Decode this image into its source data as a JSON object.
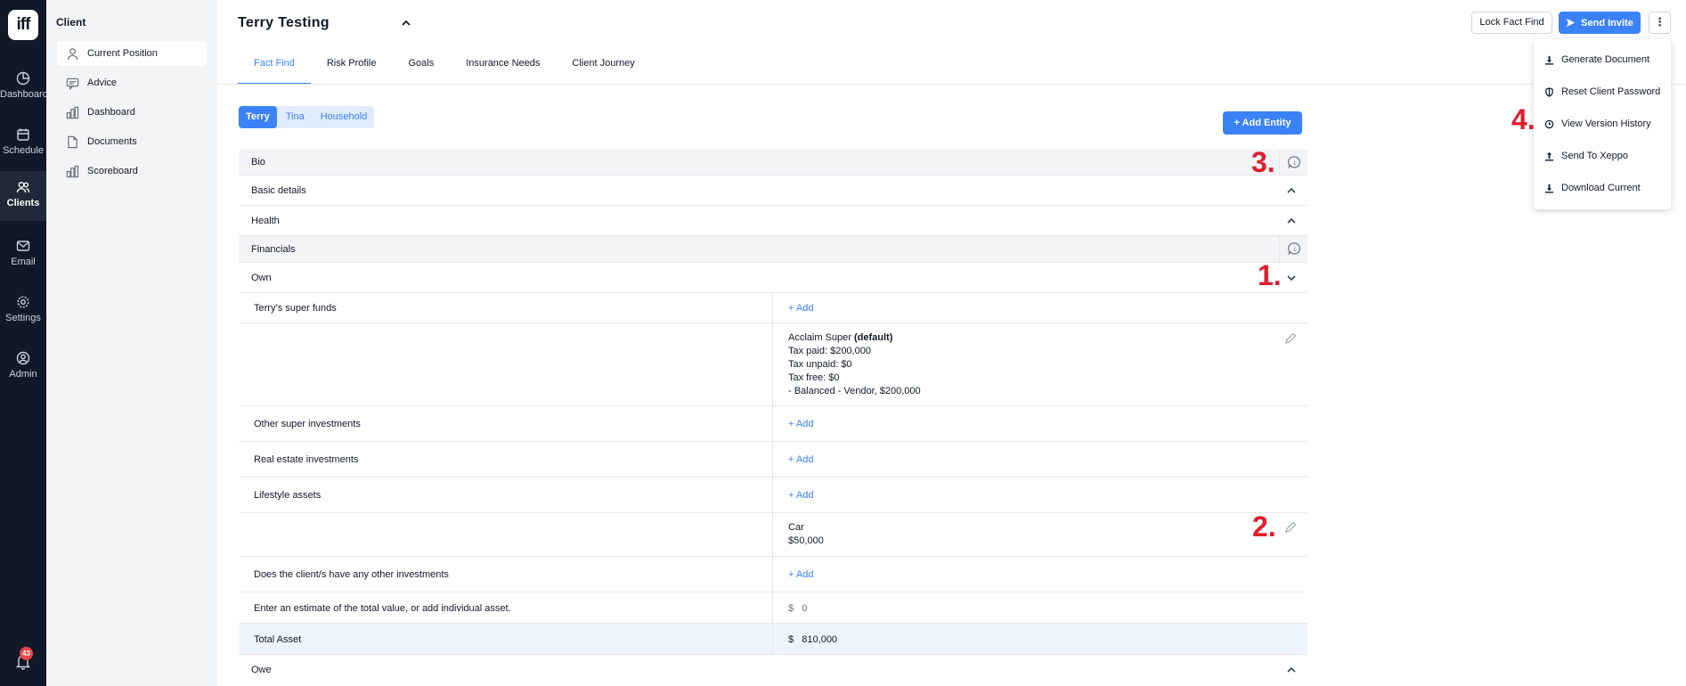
{
  "rail": {
    "logo": "iff",
    "items": [
      {
        "label": "Dashboard"
      },
      {
        "label": "Schedule"
      },
      {
        "label": "Clients"
      },
      {
        "label": "Email"
      },
      {
        "label": "Settings"
      },
      {
        "label": "Admin"
      }
    ],
    "notification_count": "43"
  },
  "sidebar": {
    "title": "Client",
    "items": [
      {
        "label": "Current Position"
      },
      {
        "label": "Advice"
      },
      {
        "label": "Dashboard"
      },
      {
        "label": "Documents"
      },
      {
        "label": "Scoreboard"
      }
    ]
  },
  "header": {
    "title": "Terry Testing",
    "lock_label": "Lock Fact Find",
    "send_invite_label": "Send Invite",
    "more_label": "⋮"
  },
  "tabs": [
    {
      "label": "Fact Find"
    },
    {
      "label": "Risk Profile"
    },
    {
      "label": "Goals"
    },
    {
      "label": "Insurance Needs"
    },
    {
      "label": "Client Journey"
    }
  ],
  "entities": {
    "pills": [
      {
        "label": "Terry"
      },
      {
        "label": "Tina"
      },
      {
        "label": "Household"
      }
    ],
    "add_label": "+ Add Entity"
  },
  "sections": {
    "bio": "Bio",
    "basic": "Basic details",
    "health": "Health",
    "financials": "Financials",
    "own": "Own",
    "owe": "Owe",
    "comment_count": "1"
  },
  "rows": {
    "super_funds": "Terry’s super funds",
    "other_super": "Other super investments",
    "real_estate": "Real estate investments",
    "lifestyle": "Lifestyle assets",
    "other_investments": "Does the client/s have any other investments",
    "estimate": "Enter an estimate of the total value, or add individual asset.",
    "total": "Total Asset",
    "add_label": "+ Add"
  },
  "super_detail": {
    "name": "Acclaim Super",
    "default_tag": "(default)",
    "line1": "Tax paid: $200,000",
    "line2": "Tax unpaid: $0",
    "line3": "Tax free: $0",
    "line4": "- Balanced - Vendor, $200,000"
  },
  "lifestyle_detail": {
    "name": "Car",
    "value": "$50,000"
  },
  "estimate_value": "$   0",
  "total_value": "$   810,000",
  "menu": {
    "items": [
      {
        "label": "Generate Document",
        "icon": "download-icon"
      },
      {
        "label": "Reset Client Password",
        "icon": "shield-icon"
      },
      {
        "label": "View Version History",
        "icon": "clock-icon"
      },
      {
        "label": "Send To Xeppo",
        "icon": "upload-icon"
      },
      {
        "label": "Download Current",
        "icon": "download-icon"
      }
    ]
  },
  "markers": {
    "m1": "1.",
    "m2": "2.",
    "m3": "3.",
    "m4": "4."
  },
  "colors": {
    "primary": "#3b82f6",
    "rail": "#111827",
    "marker": "#e11d2e"
  }
}
